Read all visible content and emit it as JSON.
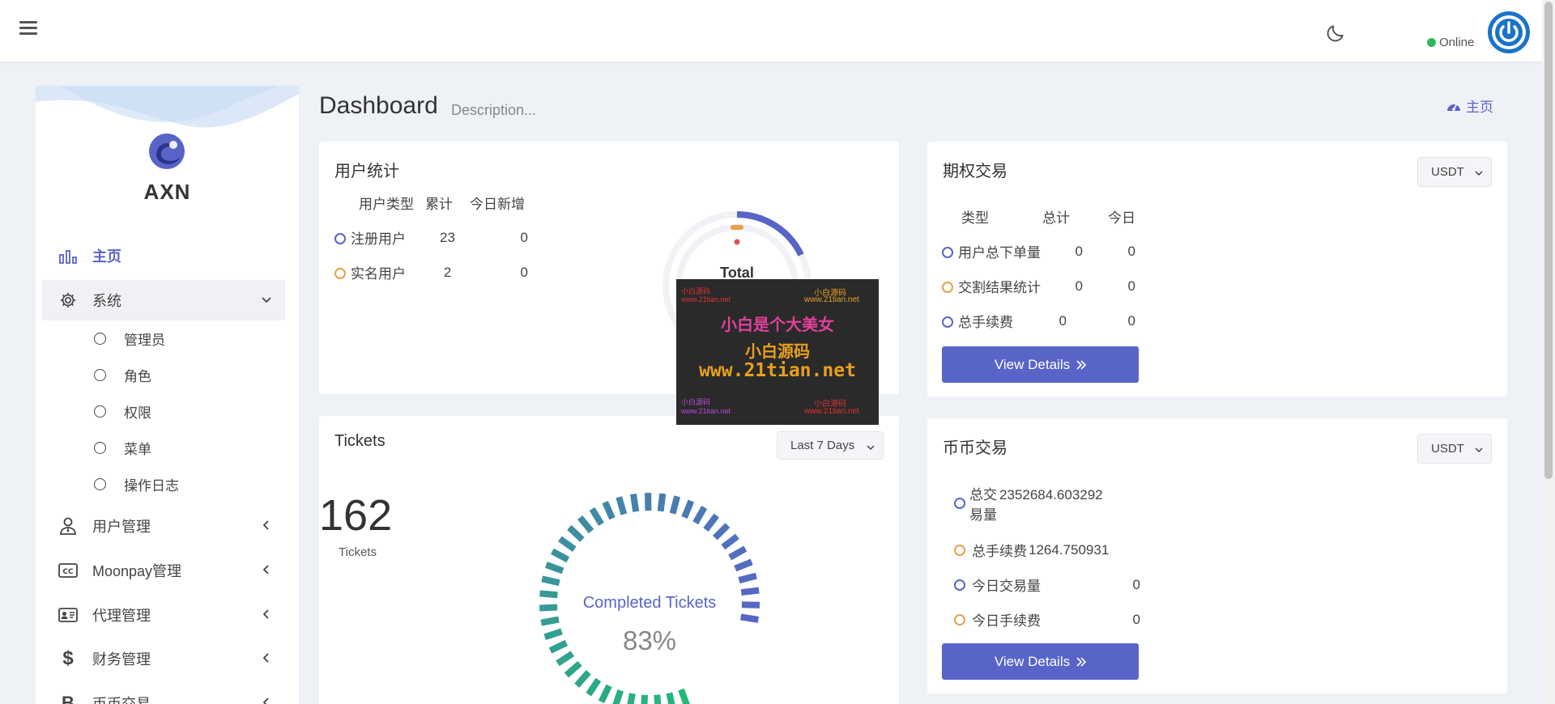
{
  "topbar": {
    "menu_icon": "hamburger-icon",
    "theme_icon": "moon-icon",
    "status_text": "Online",
    "status_color": "#2dba5f"
  },
  "sidebar": {
    "brand": "AXN",
    "items": [
      {
        "label": "主页",
        "icon": "bar-chart-icon",
        "active": true
      },
      {
        "label": "系统",
        "icon": "gear-icon",
        "open": true
      },
      {
        "label": "用户管理",
        "icon": "user-tie-icon"
      },
      {
        "label": "Moonpay管理",
        "icon": "cc-icon"
      },
      {
        "label": "代理管理",
        "icon": "id-card-icon"
      },
      {
        "label": "财务管理",
        "icon": "dollar-icon"
      },
      {
        "label": "币币交易",
        "icon": "bitcoin-icon"
      }
    ],
    "sub_items": [
      "管理员",
      "角色",
      "权限",
      "菜单",
      "操作日志"
    ]
  },
  "header": {
    "title": "Dashboard",
    "description": "Description...",
    "breadcrumb": "主页"
  },
  "user_stats": {
    "title": "用户统计",
    "columns": [
      "用户类型",
      "累计",
      "今日新增"
    ],
    "rows": [
      {
        "type": "注册用户",
        "total": "23",
        "today": "0"
      },
      {
        "type": "实名用户",
        "total": "2",
        "today": "0"
      }
    ],
    "donut_label": "Total"
  },
  "options_trading": {
    "title": "期权交易",
    "currency": "USDT",
    "columns": [
      "类型",
      "总计",
      "今日"
    ],
    "rows": [
      {
        "type": "用户总下单量",
        "total": "0",
        "today": "0"
      },
      {
        "type": "交割结果统计",
        "total": "0",
        "today": "0"
      },
      {
        "type": "总手续费",
        "total": "0",
        "today": "0"
      }
    ],
    "button": "View Details"
  },
  "tickets": {
    "title": "Tickets",
    "range": "Last 7 Days",
    "count": "162",
    "count_label": "Tickets",
    "gauge_label": "Completed Tickets",
    "gauge_value": "83%",
    "gauge_fraction": 0.83
  },
  "coin_trading": {
    "title": "币币交易",
    "currency": "USDT",
    "rows": [
      {
        "label": "总交易量",
        "value": "2352684.603292"
      },
      {
        "label": "总手续费",
        "value": "1264.750931"
      },
      {
        "label": "今日交易量",
        "value": "0"
      },
      {
        "label": "今日手续费",
        "value": "0"
      }
    ],
    "button": "View Details"
  },
  "watermark": {
    "line1": "小白是个大美女",
    "line2": "小白源码",
    "line3": "www.21tian.net",
    "small_a": "小白源码",
    "small_b": "www.21tian.net"
  },
  "colors": {
    "accent": "#5964c8",
    "orange": "#e8a04a"
  }
}
